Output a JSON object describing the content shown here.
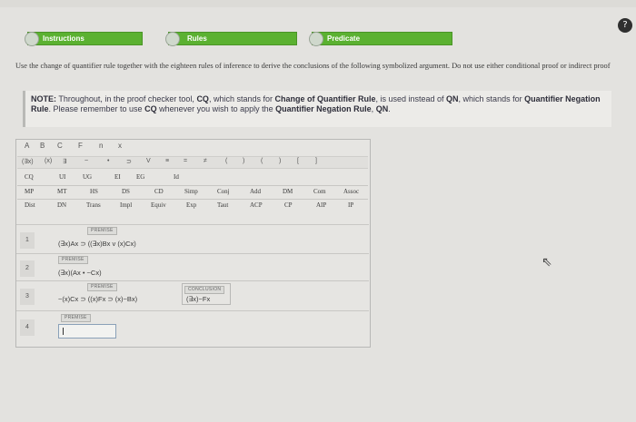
{
  "tabs": {
    "instructions": "Instructions",
    "rules": "Rules",
    "predicate": "Predicate"
  },
  "help_glyph": "?",
  "instructions_text": "Use the change of quantifier rule together with the eighteen rules of inference to derive the conclusions of the following symbolized argument. Do not use either conditional proof or indirect proof",
  "note": {
    "prefix": "NOTE:",
    "t1": " Throughout, in the proof checker tool, ",
    "cq": "CQ",
    "t2": ", which stands for ",
    "cqr": "Change of Quantifier Rule",
    "t3": ", is used instead of ",
    "qn": "QN",
    "t4": ", which stands for ",
    "qnr": "Quantifier Negation Rule",
    "t5": ". Please remember to use ",
    "cq2": "CQ",
    "t6": " whenever you wish to apply the ",
    "qnr2": "Quantifier Negation Rule",
    "t7": ", ",
    "qn2": "QN",
    "t8": "."
  },
  "tool": {
    "tabs": [
      "A",
      "B",
      "C",
      "F",
      "n",
      "x"
    ],
    "symbols": [
      "(∃x)",
      "(x)",
      "∃",
      "~",
      "•",
      "⊃",
      "V",
      "≡",
      "=",
      "≠",
      "(",
      ")",
      "(",
      ")",
      "[",
      "]"
    ],
    "rules_row1": [
      "CQ",
      "UI",
      "UG",
      "EI",
      "EG",
      "Id"
    ],
    "rules_row2": [
      "MP",
      "MT",
      "HS",
      "DS",
      "CD",
      "Simp",
      "Conj",
      "Add",
      "DM",
      "Com",
      "Assoc"
    ],
    "rules_row3": [
      "Dist",
      "DN",
      "Trans",
      "Impl",
      "Equiv",
      "Exp",
      "Taut",
      "ACP",
      "CP",
      "AIP",
      "IP"
    ]
  },
  "proof": {
    "lines": [
      {
        "num": "1",
        "tag": "PREMISE",
        "formula": "(∃x)Ax ⊃ ((∃x)Bx v (x)Cx)"
      },
      {
        "num": "2",
        "tag": "PREMISE",
        "formula": "(∃x)(Ax • ~Cx)"
      },
      {
        "num": "3",
        "tag": "PREMISE",
        "formula": "~(x)Cx ⊃ ((x)Fx ⊃ (x)~Bx)"
      },
      {
        "num": "4",
        "tag": "PREMISE",
        "formula": ""
      }
    ],
    "conclusion_tag": "CONCLUSION",
    "conclusion": "(∃x)~Fx"
  }
}
